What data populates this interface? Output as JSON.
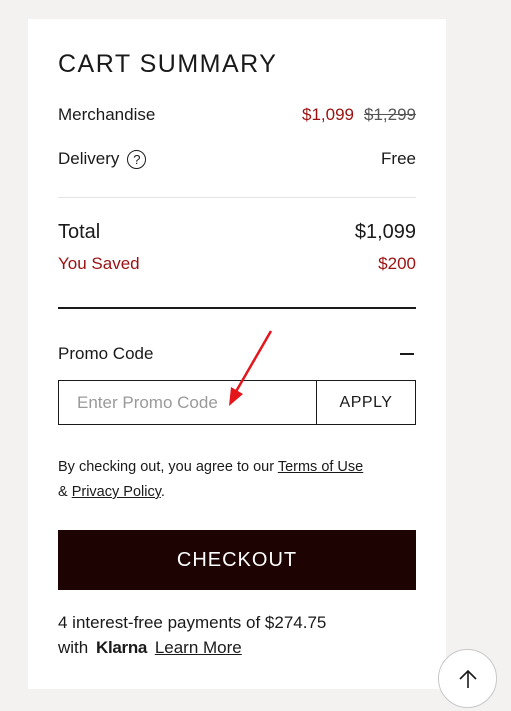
{
  "summary": {
    "title": "CART SUMMARY",
    "merchandise_label": "Merchandise",
    "merchandise_sale_price": "$1,099",
    "merchandise_original_price": "$1,299",
    "delivery_label": "Delivery",
    "delivery_help_glyph": "?",
    "delivery_value": "Free",
    "total_label": "Total",
    "total_value": "$1,099",
    "saved_label": "You Saved",
    "saved_value": "$200"
  },
  "promo": {
    "label": "Promo Code",
    "toggle_icon": "minus-icon",
    "input_placeholder": "Enter Promo Code",
    "input_value": "",
    "apply_label": "APPLY"
  },
  "terms": {
    "prefix": "By checking out, you agree to our",
    "terms_link": "Terms of Use",
    "ampersand": "&",
    "privacy_link": "Privacy Policy",
    "suffix": "."
  },
  "checkout": {
    "label": "CHECKOUT"
  },
  "klarna": {
    "line1": "4 interest-free payments of $274.75",
    "with": "with",
    "brand": "Klarna",
    "learn_more": "Learn More"
  },
  "scroll_top": {
    "icon": "arrow-up-icon"
  },
  "colors": {
    "sale_red": "#9b1111",
    "checkout_bg": "#1e0303",
    "page_bg": "#f3f2f0",
    "annotation_red": "#e5161b"
  }
}
